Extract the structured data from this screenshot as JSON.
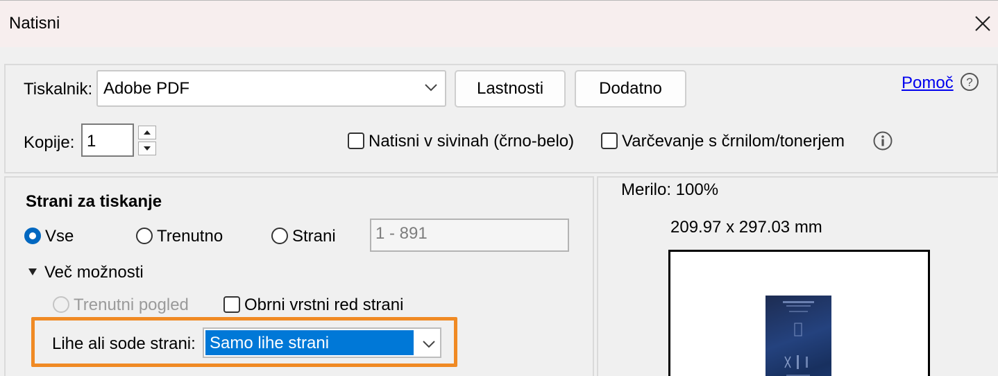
{
  "window": {
    "title": "Natisni"
  },
  "printer": {
    "label": "Tiskalnik:",
    "selected": "Adobe PDF",
    "properties_button": "Lastnosti",
    "advanced_button": "Dodatno",
    "help_link": "Pomoč"
  },
  "copies": {
    "label": "Kopije:",
    "value": "1"
  },
  "options": {
    "grayscale_label": "Natisni v sivinah (črno-belo)",
    "grayscale_checked": false,
    "ink_saving_label": "Varčevanje s črnilom/tonerjem",
    "ink_saving_checked": false
  },
  "pages": {
    "heading": "Strani za tiskanje",
    "radio_all": "Vse",
    "radio_current": "Trenutno",
    "radio_pages": "Strani",
    "selected": "all",
    "range_value": "1 - 891",
    "more_options": "Več možnosti",
    "current_view": "Trenutni pogled",
    "reverse_order": "Obrni vrstni red strani",
    "reverse_checked": false,
    "odd_even_label": "Lihe ali sode strani:",
    "odd_even_value": "Samo lihe strani"
  },
  "preview": {
    "scale": "Merilo: 100%",
    "dimensions": "209.97 x 297.03 mm"
  },
  "colors": {
    "accent": "#0067c0",
    "highlight": "#f08a24",
    "selection": "#0078d7"
  }
}
